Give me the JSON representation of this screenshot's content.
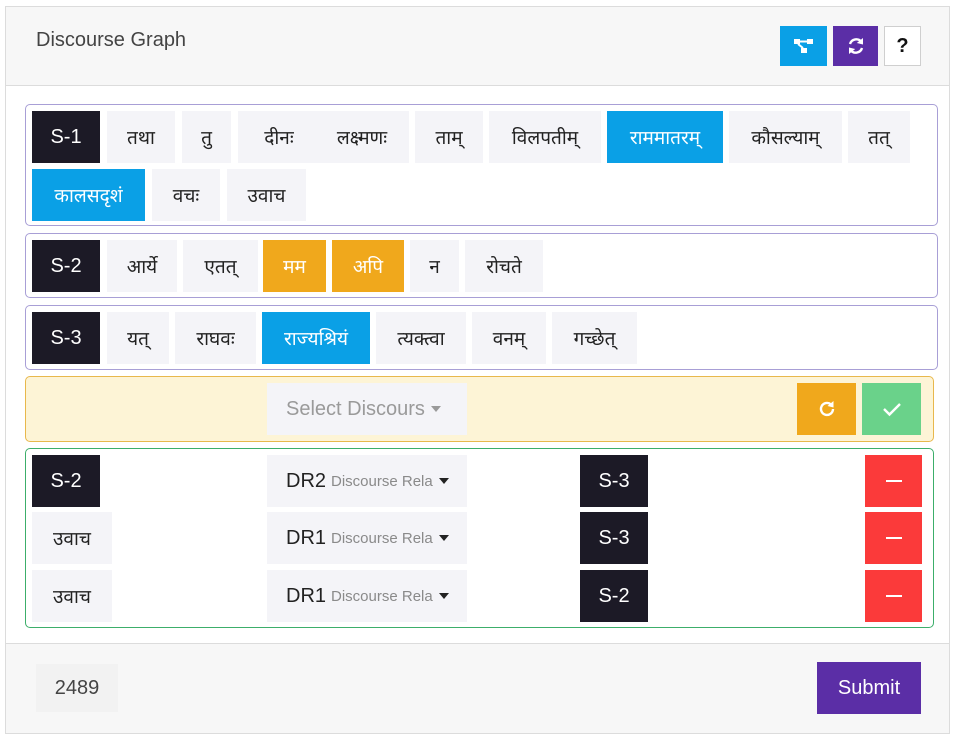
{
  "header": {
    "title": "Discourse Graph",
    "buttons": {
      "graph_icon": "graph-icon",
      "refresh_icon": "refresh-icon",
      "help_label": "?"
    }
  },
  "sentences": [
    {
      "id": "S-1",
      "tokens": [
        "तथा",
        "तु",
        "दीनः",
        "लक्ष्मणः",
        "ताम्",
        "विलपतीम्",
        "राममातरम्",
        "कौसल्याम्",
        "तत्",
        "कालसदृशं",
        "वचः",
        "उवाच"
      ]
    },
    {
      "id": "S-2",
      "tokens": [
        "आर्ये",
        "एतत्",
        "मम",
        "अपि",
        "न",
        "रोचते"
      ]
    },
    {
      "id": "S-3",
      "tokens": [
        "यत्",
        "राघवः",
        "राज्यश्रियं",
        "त्यक्त्वा",
        "वनम्",
        "गच्छेत्"
      ]
    }
  ],
  "selector": {
    "placeholder": "Select Discours",
    "reset_icon": "refresh-icon",
    "confirm_icon": "check-icon"
  },
  "relations": [
    {
      "source": "S-2",
      "code": "DR2",
      "hint": "Discourse Relation",
      "target": "S-3"
    },
    {
      "source": "उवाच",
      "code": "DR1",
      "hint": "Discourse Relation",
      "target": "S-3"
    },
    {
      "source": "उवाच",
      "code": "DR1",
      "hint": "Discourse Relation",
      "target": "S-2"
    }
  ],
  "footer": {
    "count": "2489",
    "submit_label": "Submit"
  },
  "colors": {
    "blue": "#0aa0e6",
    "purple": "#5b2ea6",
    "orange": "#f0a81c",
    "green": "#6ad28a",
    "red": "#fb3a3a",
    "dark": "#1c1a26"
  }
}
